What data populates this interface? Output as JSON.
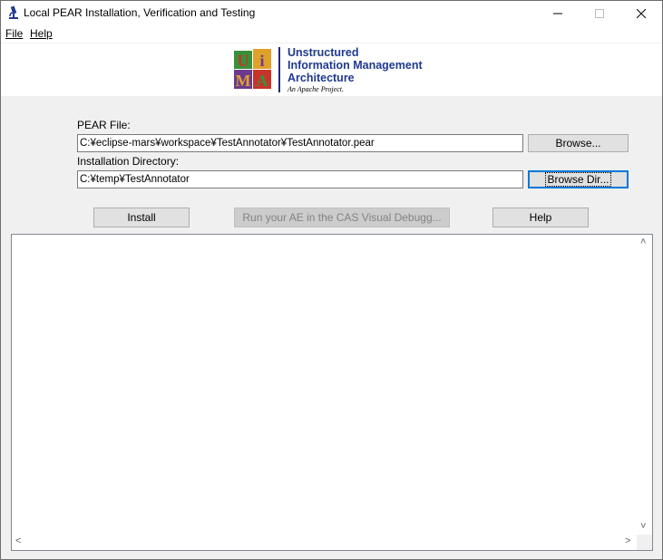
{
  "window": {
    "title": "Local PEAR Installation, Verification and Testing",
    "min_glyph": "—",
    "max_glyph": "☐",
    "close_glyph": "✕"
  },
  "menu": {
    "file": "File",
    "help": "Help"
  },
  "logo": {
    "line1": "Unstructured",
    "line2": "Information Management",
    "line3": "Architecture",
    "tagline": "An Apache Project.",
    "letters": [
      "U",
      "i",
      "M",
      "A"
    ],
    "colors": {
      "brand": "#1f3a8f",
      "green": "#3a8f3a",
      "red": "#c8342a",
      "gold": "#e0a12a",
      "purple": "#6b3a8f"
    }
  },
  "pear": {
    "label": "PEAR File:",
    "value": "C:¥eclipse-mars¥workspace¥TestAnnotator¥TestAnnotator.pear",
    "browse": "Browse..."
  },
  "install_dir": {
    "label": "Installation Directory:",
    "value": "C:¥temp¥TestAnnotator",
    "browse": "Browse Dir..."
  },
  "actions": {
    "install": "Install",
    "run": "Run your AE in the CAS Visual Debugg...",
    "help": "Help"
  },
  "output": {
    "text": "",
    "scroll_up": "˄",
    "scroll_down": "˅",
    "scroll_left": "<",
    "scroll_right": ">"
  }
}
